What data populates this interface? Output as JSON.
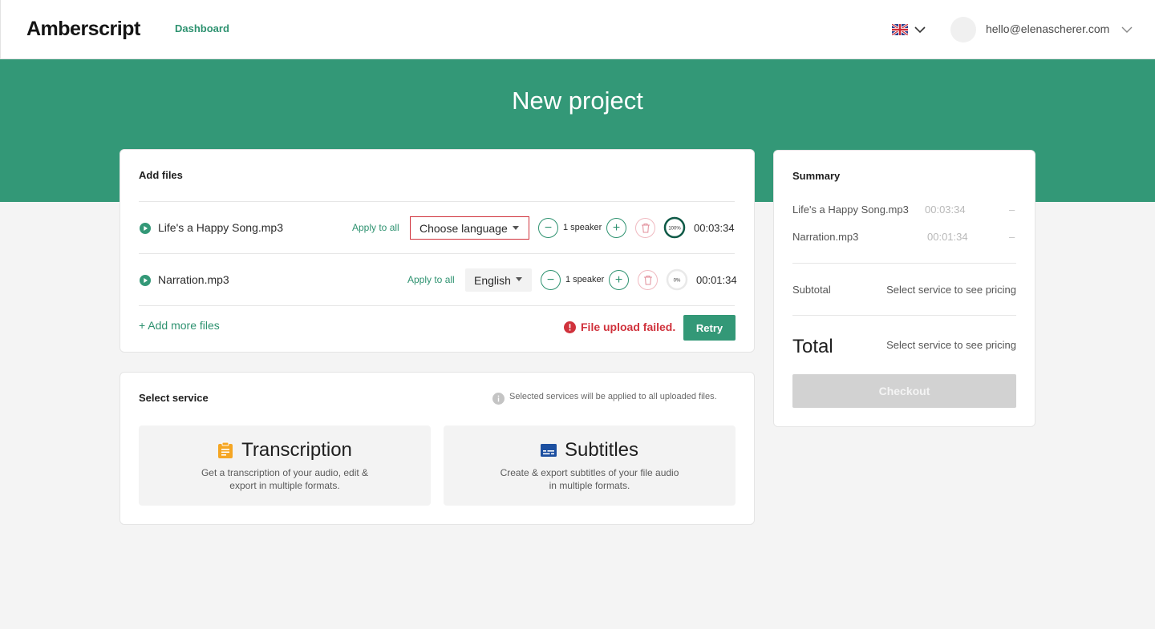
{
  "header": {
    "logo": "Amberscript",
    "nav_dashboard": "Dashboard",
    "language_flag_icon": "uk-flag-icon",
    "user_email": "hello@elenascherer.com"
  },
  "hero": {
    "title": "New project"
  },
  "add_files": {
    "title": "Add files",
    "files": [
      {
        "name": "Life's a Happy Song.mp3",
        "apply_all": "Apply to all",
        "language": "Choose language",
        "speakers": "1 speaker",
        "progress_label": "100%",
        "progress": 1.0,
        "duration": "00:03:34"
      },
      {
        "name": "Narration.mp3",
        "apply_all": "Apply to all",
        "language": "English",
        "speakers": "1 speaker",
        "progress_label": "0%",
        "progress": 0.0,
        "duration": "00:01:34"
      }
    ],
    "add_more": "+ Add more files",
    "error": "File upload failed.",
    "retry": "Retry"
  },
  "select_service": {
    "title": "Select service",
    "info": "Selected services will be applied to all uploaded files.",
    "services": [
      {
        "title": "Transcription",
        "icon": "clipboard-icon",
        "description": "Get a transcription of your audio, edit & export in multiple formats."
      },
      {
        "title": "Subtitles",
        "icon": "subtitles-icon",
        "description": "Create & export subtitles of your file audio in multiple formats."
      }
    ]
  },
  "summary": {
    "title": "Summary",
    "items": [
      {
        "name": "Life's a Happy Song.mp3",
        "duration": "00:03:34",
        "price": "–"
      },
      {
        "name": "Narration.mp3",
        "duration": "00:01:34",
        "price": "–"
      }
    ],
    "subtotal_label": "Subtotal",
    "subtotal_value": "Select service to see pricing",
    "total_label": "Total",
    "total_value": "Select service to see pricing",
    "checkout": "Checkout"
  },
  "colors": {
    "brand_green": "#339877",
    "error_red": "#d0323c",
    "transcription_icon": "#f5a623",
    "subtitles_icon": "#1c4fa0"
  }
}
